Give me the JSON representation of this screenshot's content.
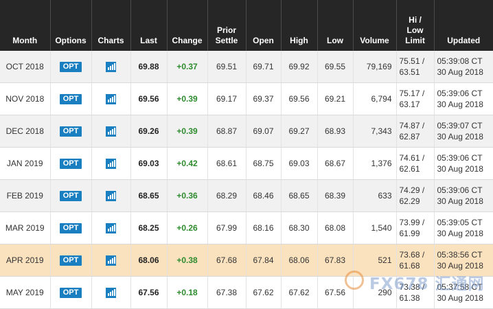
{
  "headers": {
    "month": "Month",
    "options": "Options",
    "charts": "Charts",
    "last": "Last",
    "change": "Change",
    "prior_settle_1": "Prior",
    "prior_settle_2": "Settle",
    "open": "Open",
    "high": "High",
    "low": "Low",
    "volume": "Volume",
    "hilo_1": "Hi /",
    "hilo_2": "Low",
    "hilo_3": "Limit",
    "updated": "Updated"
  },
  "opt_label": "OPT",
  "chart_icon": "bar-chart-icon",
  "accent_color": "#1a7fc1",
  "highlight_color": "#fbe2bf",
  "positive_color": "#2e8b2e",
  "rows": [
    {
      "month": "OCT 2018",
      "last": "69.88",
      "change": "+0.37",
      "prior": "69.51",
      "open": "69.71",
      "high": "69.92",
      "low": "69.55",
      "volume": "79,169",
      "hi": "75.51 /",
      "lo": "63.51",
      "time": "05:39:08 CT",
      "date": "30 Aug 2018"
    },
    {
      "month": "NOV 2018",
      "last": "69.56",
      "change": "+0.39",
      "prior": "69.17",
      "open": "69.37",
      "high": "69.56",
      "low": "69.21",
      "volume": "6,794",
      "hi": "75.17 /",
      "lo": "63.17",
      "time": "05:39:06 CT",
      "date": "30 Aug 2018"
    },
    {
      "month": "DEC 2018",
      "last": "69.26",
      "change": "+0.39",
      "prior": "68.87",
      "open": "69.07",
      "high": "69.27",
      "low": "68.93",
      "volume": "7,343",
      "hi": "74.87 /",
      "lo": "62.87",
      "time": "05:39:07 CT",
      "date": "30 Aug 2018"
    },
    {
      "month": "JAN 2019",
      "last": "69.03",
      "change": "+0.42",
      "prior": "68.61",
      "open": "68.75",
      "high": "69.03",
      "low": "68.67",
      "volume": "1,376",
      "hi": "74.61 /",
      "lo": "62.61",
      "time": "05:39:06 CT",
      "date": "30 Aug 2018"
    },
    {
      "month": "FEB 2019",
      "last": "68.65",
      "change": "+0.36",
      "prior": "68.29",
      "open": "68.46",
      "high": "68.65",
      "low": "68.39",
      "volume": "633",
      "hi": "74.29 /",
      "lo": "62.29",
      "time": "05:39:06 CT",
      "date": "30 Aug 2018"
    },
    {
      "month": "MAR 2019",
      "last": "68.25",
      "change": "+0.26",
      "prior": "67.99",
      "open": "68.16",
      "high": "68.30",
      "low": "68.08",
      "volume": "1,540",
      "hi": "73.99 /",
      "lo": "61.99",
      "time": "05:39:05 CT",
      "date": "30 Aug 2018"
    },
    {
      "month": "APR 2019",
      "last": "68.06",
      "change": "+0.38",
      "prior": "67.68",
      "open": "67.84",
      "high": "68.06",
      "low": "67.83",
      "volume": "521",
      "hi": "73.68 /",
      "lo": "61.68",
      "time": "05:38:56 CT",
      "date": "30 Aug 2018"
    },
    {
      "month": "MAY 2019",
      "last": "67.56",
      "change": "+0.18",
      "prior": "67.38",
      "open": "67.62",
      "high": "67.62",
      "low": "67.56",
      "volume": "290",
      "hi": "73.38 /",
      "lo": "61.38",
      "time": "05:37:58 CT",
      "date": "30 Aug 2018"
    }
  ],
  "highlight_row": 6,
  "watermark": "FX678 汇通网"
}
